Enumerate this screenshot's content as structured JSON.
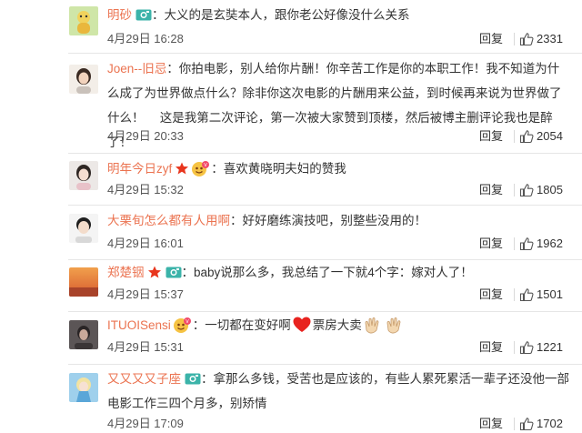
{
  "reply_label": "回复",
  "colors": {
    "name": "#eb7350",
    "text": "#333333",
    "meta": "#555555",
    "divider": "#e6e6e6"
  },
  "comments": [
    {
      "name": "明砂",
      "badges": [
        "camera-badge-icon"
      ],
      "text": "：大义的是玄奘本人，跟你老公好像没什么关系",
      "time": "4月29日 16:28",
      "likes": "2331"
    },
    {
      "name": "Joen--旧忌",
      "badges": [],
      "text": "：你拍电影，别人给你片酬！你辛苦工作是你的本职工作！我不知道为什么成了为世界做点什么？除非你这次电影的片酬用来公益，到时候再来说为世界做了什么！　 这是我第二次评论，第一次被大家赞到顶楼，然后被博主删评论我也是醉了！",
      "time": "4月29日 20:33",
      "likes": "2054"
    },
    {
      "name": "明年今日zyf",
      "badges": [
        "vip-star-icon",
        "fan-emoji-icon"
      ],
      "text": "：喜欢黄晓明夫妇的赞我",
      "time": "4月29日 15:32",
      "likes": "1805"
    },
    {
      "name": "大栗旬怎么都有人用啊",
      "badges": [],
      "text": "：好好磨练演技吧，别整些没用的！",
      "time": "4月29日 16:01",
      "likes": "1962"
    },
    {
      "name": "郑楚铟",
      "badges": [
        "vip-star-icon",
        "camera-badge-icon"
      ],
      "text": "：baby说那么多，我总结了一下就4个字：嫁对人了！",
      "time": "4月29日 15:37",
      "likes": "1501"
    },
    {
      "name": "ITUOISensi",
      "badges": [
        "fan-emoji-icon"
      ],
      "text_parts": [
        "：一切都在变好啊",
        "heart-emoji-icon",
        "票房大卖",
        "clap-emoji-icon",
        "clap-emoji-icon"
      ],
      "text": "",
      "time": "4月29日 15:31",
      "likes": "1221"
    },
    {
      "name": "又又又又子座",
      "badges": [
        "camera-badge-icon"
      ],
      "text": "：拿那么多钱，受苦也是应该的，有些人累死累活一辈子还没他一部电影工作三四个月多，别矫情",
      "time": "4月29日 17:09",
      "likes": "1702"
    }
  ]
}
